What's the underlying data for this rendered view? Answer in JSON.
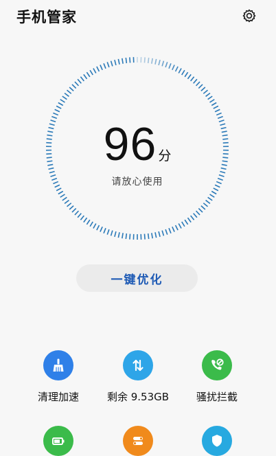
{
  "header": {
    "title": "手机管家",
    "settings_icon": "gear-icon"
  },
  "gauge": {
    "score": "96",
    "unit": "分",
    "status": "请放心使用",
    "tick_color": "#2a79b8"
  },
  "optimize": {
    "label": "一键优化",
    "color": "#1f5bb5"
  },
  "tools": [
    {
      "label": "清理加速",
      "icon": "broom-icon",
      "color": "#2f80e8"
    },
    {
      "label": "剩余 9.53GB",
      "icon": "transfer-arrows-icon",
      "color": "#2ea5e8"
    },
    {
      "label": "骚扰拦截",
      "icon": "phone-block-icon",
      "color": "#3bbb4a"
    }
  ],
  "tools_row2": [
    {
      "icon": "battery-icon",
      "color": "#3bbb4a"
    },
    {
      "icon": "app-toggle-icon",
      "color": "#f08a1c"
    },
    {
      "icon": "shield-icon",
      "color": "#27a9e0"
    }
  ]
}
